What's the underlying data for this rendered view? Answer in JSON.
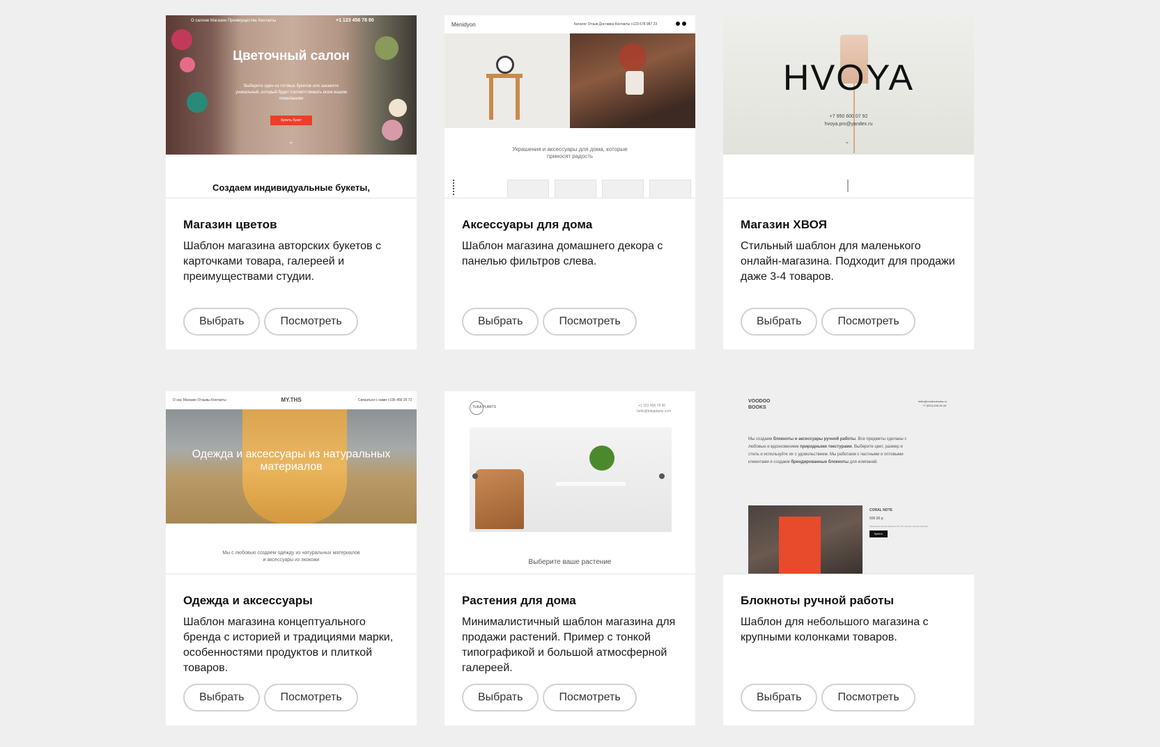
{
  "cards": [
    {
      "title": "Магазин цветов",
      "desc": "Шаблон магазина авторских букетов с карточками товара, галереей и преимуществами студии.",
      "select": "Выбрать",
      "preview": "Посмотреть",
      "thumb": {
        "nav": "О салоне   Магазин   Преимущества   Контакты",
        "phone": "+1 123 456 78 90",
        "hero_title": "Цветочный салон",
        "hero_sub": "Выберите один из готовых букетов или закажите уникальный, который будет соответствовать всем вашим пожеланиям",
        "hero_btn": "Купить букет",
        "heading": "Создаем индивидуальные букеты,"
      }
    },
    {
      "title": "Аксессуары для дома",
      "desc": "Шаблон магазина домашнего декора с панелью фильтров слева.",
      "select": "Выбрать",
      "preview": "Посмотреть",
      "thumb": {
        "logo": "Menidyon",
        "nav": "Каталог   Отзыв   Доставка   Контакты   +123 678 987 23",
        "tagline": "Украшения и аксессуары для дома, которые приносят радость"
      }
    },
    {
      "title": "Магазин ХВОЯ",
      "desc": "Стильный шаблон для маленького онлайн-магазина. Подходит для продажи даже 3-4 товаров.",
      "select": "Выбрать",
      "preview": "Посмотреть",
      "thumb": {
        "logo": "HVOYA",
        "phone": "+7 950 600 07 92",
        "email": "hvoya.pro@yandex.ru"
      }
    },
    {
      "title": "Одежда и аксессуары",
      "desc": "Шаблон магазина концептуального бренда с историей и традициями марки, особенностями продуктов и плиткой товаров.",
      "select": "Выбрать",
      "preview": "Посмотреть",
      "thumb": {
        "nav": "О нас    Магазин    Отзывы    Контакты",
        "logo": "MY.THS",
        "contact": "Связаться с нами +195 456 35 72",
        "hero_title": "Одежда и аксессуары из натуральных материалов",
        "tagline": "Мы с любовью создаем одежду из натуральных материалов и аксессуары из экокожи"
      }
    },
    {
      "title": "Растения для дома",
      "desc": "Минималистичный шаблон магазина для продажи растений. Пример с тонкой типографикой и большой атмосферной галереей.",
      "select": "Выбрать",
      "preview": "Посмотреть",
      "thumb": {
        "logo": "TUKA PLANTS",
        "phone": "+1 323 456 78 90",
        "email": "hello@tukaplants.com",
        "caption": "Выберите ваше растение"
      }
    },
    {
      "title": "Блокноты ручной работы",
      "desc": "Шаблон для небольшого магазина с крупными колонками товаров.",
      "select": "Выбрать",
      "preview": "Посмотреть",
      "thumb": {
        "logo": "VOODOO BOOKS",
        "email": "hello@voodoobooks.ru",
        "phone": "+7 (922) 636-34-34",
        "intro_a": "Мы создаем ",
        "intro_b": "блокноты и аксессуары ручной работы",
        "intro_c": ". Все предметы сделаны с любовью и вдохновением ",
        "intro_d": "природными текстурами",
        "intro_e": ". Выберите цвет, размер и стиль и используйте их с удовольствием. Мы работаем с частными и оптовыми клиентами и создаем ",
        "intro_f": "брендированные блокноты",
        "intro_g": " для компаний.",
        "product_name": "CORAL NOTE",
        "product_price": "500.00 р.",
        "product_desc": "Украшение вашей формата A5. 80 страниц, мягкая обложка",
        "product_btn": "Купить"
      }
    }
  ]
}
